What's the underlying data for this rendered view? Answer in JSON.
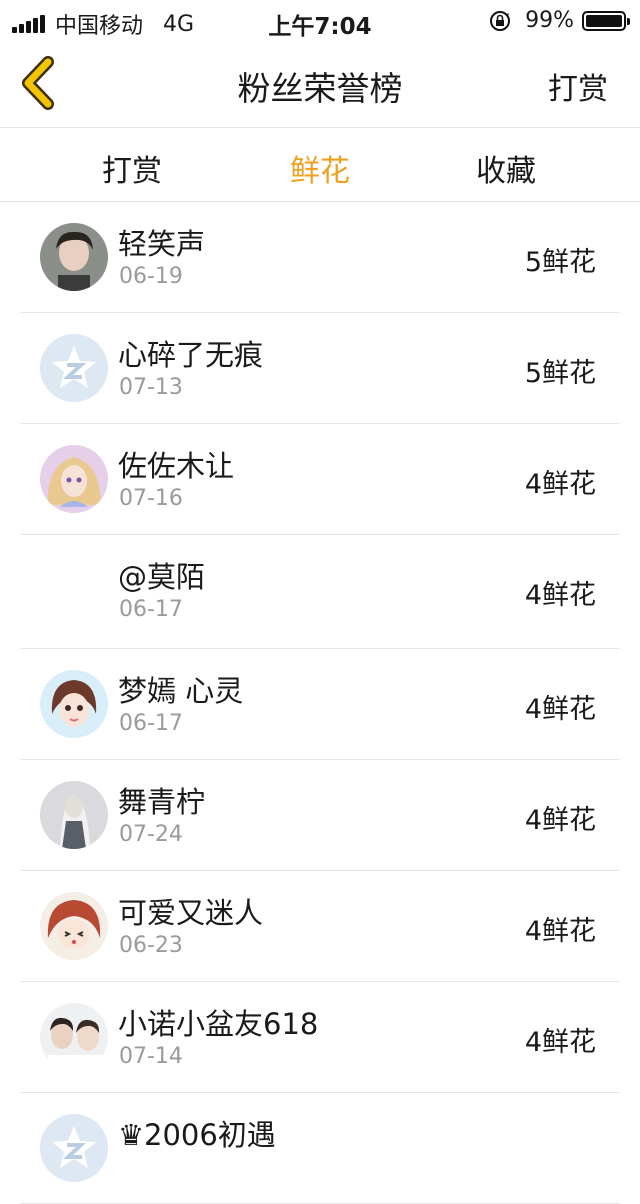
{
  "status_bar": {
    "carrier": "中国移动",
    "network": "4G",
    "time": "上午7:04",
    "battery": "99%",
    "battery_level": 0.99
  },
  "nav": {
    "title": "粉丝荣誉榜",
    "right_action": "打赏"
  },
  "tabs": [
    {
      "label": "打赏",
      "active": false
    },
    {
      "label": "鲜花",
      "active": true
    },
    {
      "label": "收藏",
      "active": false
    }
  ],
  "colors": {
    "accent": "#f0a020",
    "divider": "#e6e6e6",
    "secondary_text": "#9a9a9a"
  },
  "fans": [
    {
      "name": "轻笑声",
      "date": "06-19",
      "count": "5鲜花",
      "avatar": "boy-photo"
    },
    {
      "name": "心碎了无痕",
      "date": "07-13",
      "count": "5鲜花",
      "avatar": "default-star"
    },
    {
      "name": "佐佐木让",
      "date": "07-16",
      "count": "4鲜花",
      "avatar": "anime-girl"
    },
    {
      "name": "@莫陌",
      "date": "06-17",
      "count": "4鲜花",
      "avatar": "none"
    },
    {
      "name": "梦嫣 心灵",
      "date": "06-17",
      "count": "4鲜花",
      "avatar": "doll-girl"
    },
    {
      "name": "舞青柠",
      "date": "07-24",
      "count": "4鲜花",
      "avatar": "anime-white"
    },
    {
      "name": "可爱又迷人",
      "date": "06-23",
      "count": "4鲜花",
      "avatar": "chibi-red"
    },
    {
      "name": "小诺小盆友618",
      "date": "07-14",
      "count": "4鲜花",
      "avatar": "boys-photo"
    },
    {
      "name": "♛2006初遇",
      "date": "",
      "count": "",
      "avatar": "default-star"
    }
  ]
}
